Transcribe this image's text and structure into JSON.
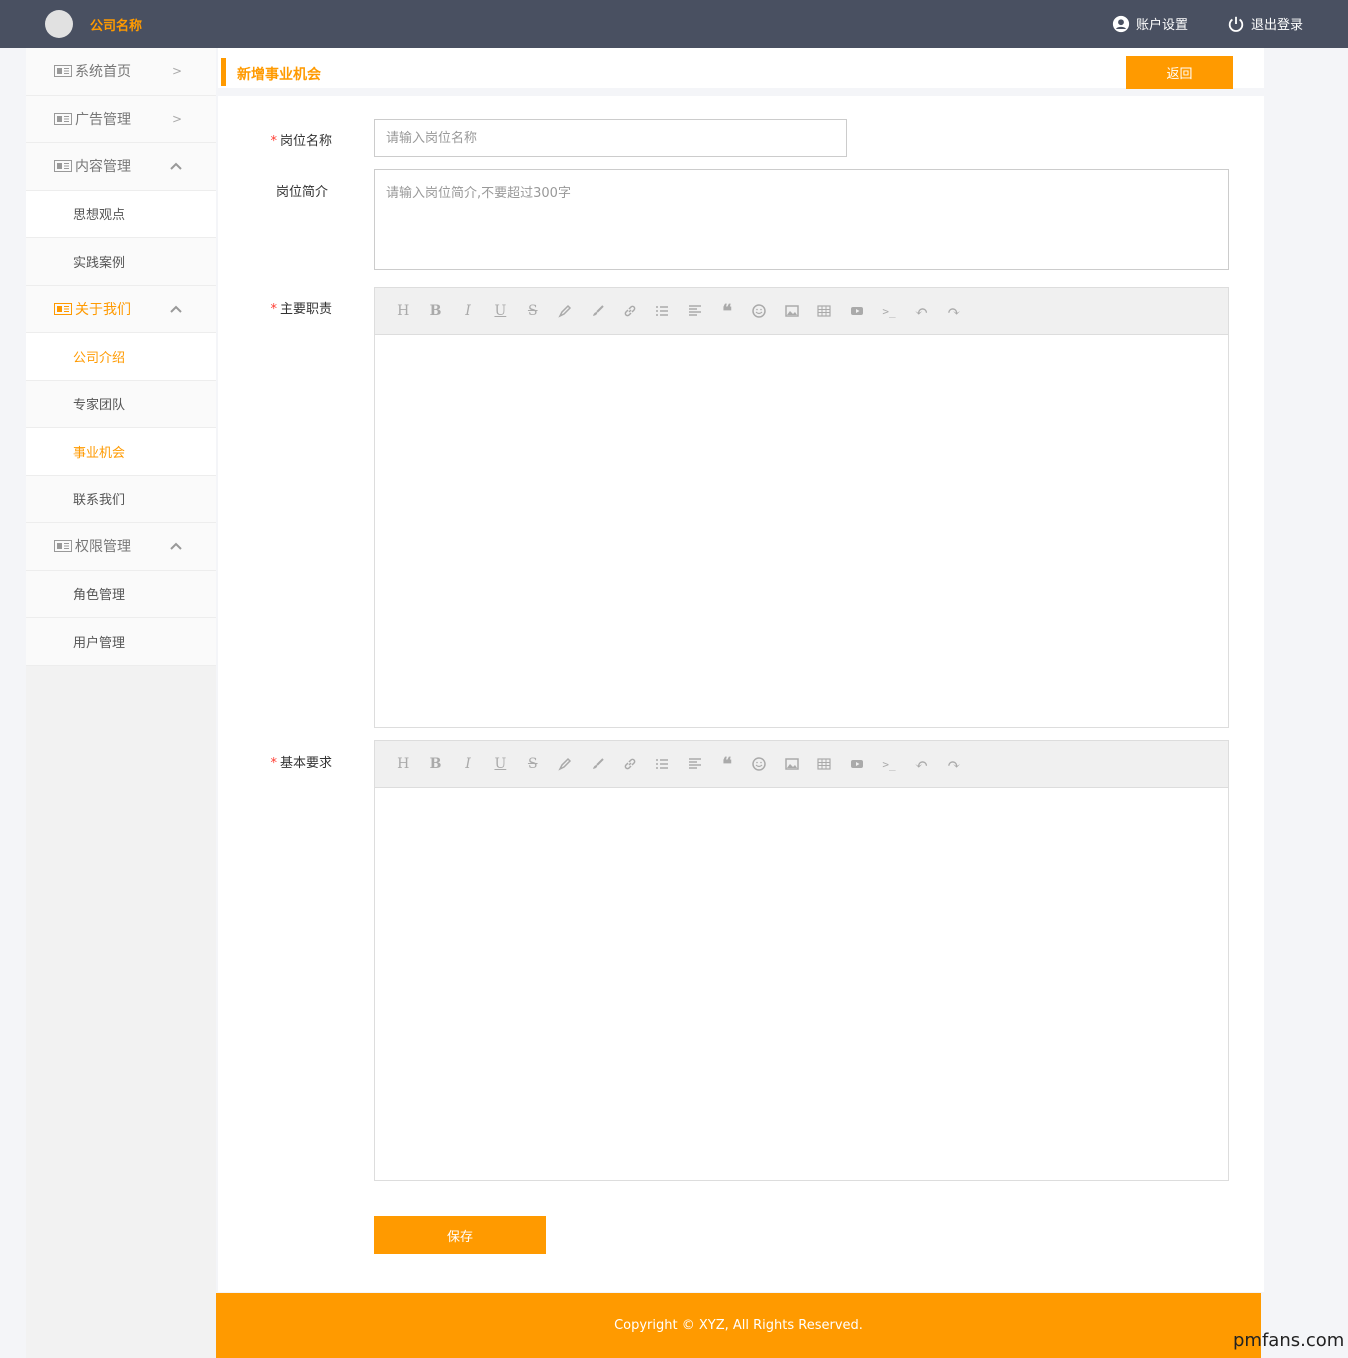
{
  "header": {
    "company_name": "公司名称",
    "account_settings": "账户设置",
    "logout": "退出登录"
  },
  "sidebar": {
    "items": [
      {
        "label": "系统首页",
        "type": "parent",
        "arrow": ">"
      },
      {
        "label": "广告管理",
        "type": "parent",
        "arrow": ">"
      },
      {
        "label": "内容管理",
        "type": "parent",
        "expanded": true
      },
      {
        "label": "思想观点",
        "type": "child"
      },
      {
        "label": "实践案例",
        "type": "child"
      },
      {
        "label": "关于我们",
        "type": "parent",
        "expanded": true,
        "active": true
      },
      {
        "label": "公司介绍",
        "type": "child",
        "active": true
      },
      {
        "label": "专家团队",
        "type": "child"
      },
      {
        "label": "事业机会",
        "type": "child",
        "active": true
      },
      {
        "label": "联系我们",
        "type": "child"
      },
      {
        "label": "权限管理",
        "type": "parent",
        "expanded": true
      },
      {
        "label": "角色管理",
        "type": "child"
      },
      {
        "label": "用户管理",
        "type": "child"
      }
    ]
  },
  "main": {
    "page_title": "新增事业机会",
    "back_label": "返回",
    "form": {
      "required_mark": "*",
      "position_name_label": "岗位名称",
      "position_name_placeholder": "请输入岗位名称",
      "position_intro_label": "岗位简介",
      "position_intro_placeholder": "请输入岗位简介,不要超过300字",
      "duties_label": "主要职责",
      "requirements_label": "基本要求",
      "save_label": "保存"
    },
    "toolbar_buttons": [
      "heading",
      "bold",
      "italic",
      "underline",
      "strikethrough",
      "highlight",
      "brush",
      "link",
      "unordered-list",
      "align",
      "quote",
      "emoji",
      "image",
      "table",
      "video",
      "code",
      "undo",
      "redo"
    ]
  },
  "footer": {
    "copyright": "Copyright © XYZ, All Rights Reserved."
  },
  "watermark": "pmfans.com",
  "colors": {
    "accent": "#ff9a00",
    "topbar": "#495061",
    "required": "#ff3b30"
  }
}
